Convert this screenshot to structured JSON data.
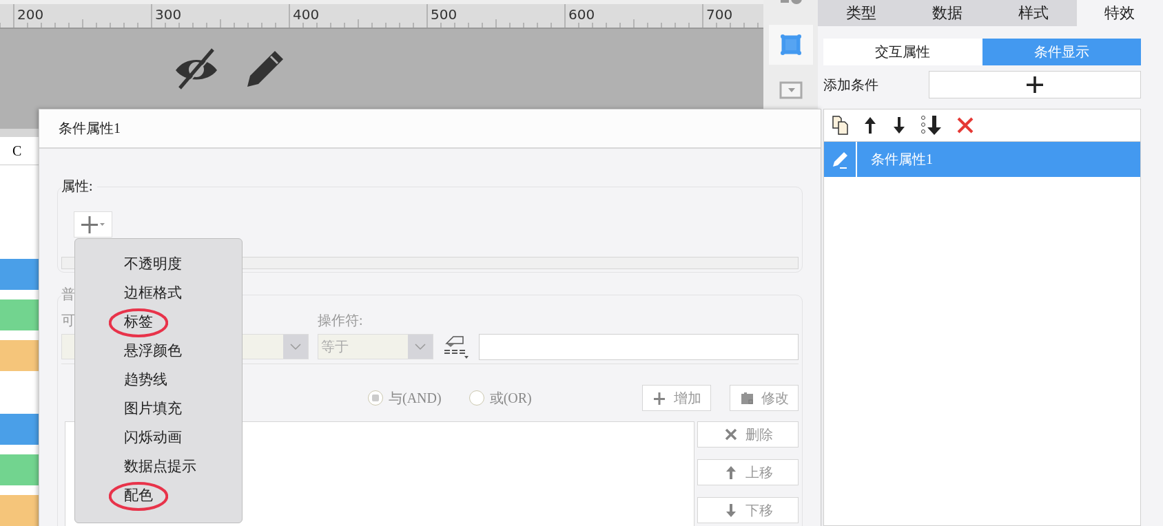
{
  "ruler": {
    "labels": [
      "200",
      "300",
      "400",
      "500",
      "600",
      "700"
    ]
  },
  "sheet": {
    "column_header": "C",
    "bars": [
      {
        "color": "#4a9fe8"
      },
      {
        "color": "#72d48f"
      },
      {
        "color": "#f5c57a"
      },
      {
        "color": "#4a9fe8"
      },
      {
        "color": "#72d48f"
      },
      {
        "color": "#f5c57a"
      }
    ]
  },
  "panel_tabs": [
    {
      "label": "类型",
      "selected": false
    },
    {
      "label": "数据",
      "selected": false
    },
    {
      "label": "样式",
      "selected": false
    },
    {
      "label": "特效",
      "selected": true
    }
  ],
  "sub_tabs": [
    {
      "label": "交互属性",
      "selected": false
    },
    {
      "label": "条件显示",
      "selected": true
    }
  ],
  "add_condition": {
    "label": "添加条件"
  },
  "conditions": [
    {
      "label": "条件属性1",
      "selected": true
    }
  ],
  "dialog": {
    "title": "条件属性1",
    "properties_legend": "属性:",
    "menu": [
      {
        "label": "不透明度",
        "circled": false
      },
      {
        "label": "边框格式",
        "circled": false
      },
      {
        "label": "标签",
        "circled": true
      },
      {
        "label": "悬浮颜色",
        "circled": false
      },
      {
        "label": "趋势线",
        "circled": false
      },
      {
        "label": "图片填充",
        "circled": false
      },
      {
        "label": "闪烁动画",
        "circled": false
      },
      {
        "label": "数据点提示",
        "circled": false
      },
      {
        "label": "配色",
        "circled": true
      }
    ],
    "common_legend": "普",
    "variable_label": "可",
    "operator_label": "操作符:",
    "operator_value": "等于",
    "logic": [
      {
        "label": "与(AND)",
        "selected": true
      },
      {
        "label": "或(OR)",
        "selected": false
      }
    ],
    "buttons": [
      {
        "label": "增加",
        "kind": "add",
        "disabled": true
      },
      {
        "label": "修改",
        "kind": "edit",
        "disabled": true
      }
    ],
    "side_buttons": [
      {
        "label": "删除",
        "kind": "delete",
        "disabled": true
      },
      {
        "label": "上移",
        "kind": "up",
        "disabled": true
      },
      {
        "label": "下移",
        "kind": "down",
        "disabled": true
      }
    ]
  }
}
